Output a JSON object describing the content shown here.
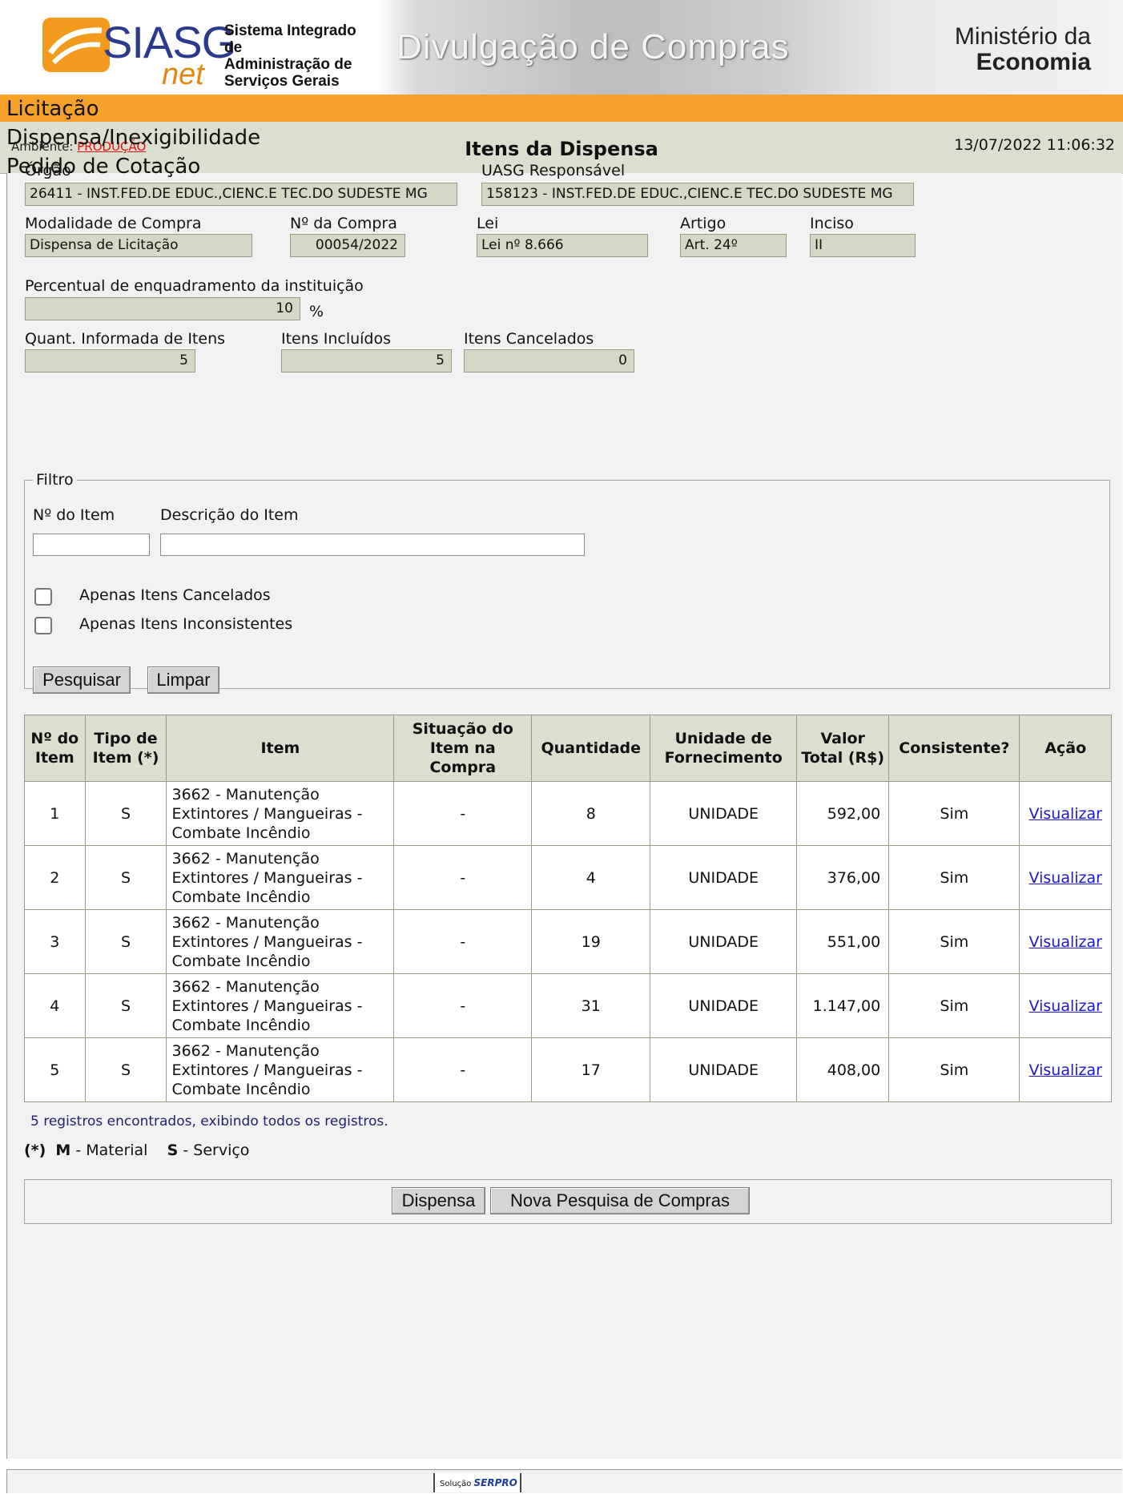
{
  "header": {
    "logo_siasg": "SIASG",
    "logo_net": "net",
    "system_name": "Sistema Integrado de\nAdministração de\nServiços Gerais",
    "site_title": "Divulgação de Compras",
    "ministry_line1": "Ministério da",
    "ministry_line2": "Economia"
  },
  "menu": {
    "items": [
      "Licitação",
      "Dispensa/Inexigibilidade",
      "Pedido de Cotação"
    ]
  },
  "title_bar": {
    "ambiente_label": "Ambiente:",
    "ambiente_value": "PRODUÇÃO",
    "title": "Itens da Dispensa",
    "datetime": "13/07/2022 11:06:32"
  },
  "form": {
    "orgao_label": "Órgão",
    "orgao_value": "26411 - INST.FED.DE EDUC.,CIENC.E TEC.DO SUDESTE MG",
    "uasg_label": "UASG Responsável",
    "uasg_value": "158123 - INST.FED.DE EDUC.,CIENC.E TEC.DO SUDESTE MG",
    "modalidade_label": "Modalidade de Compra",
    "modalidade_value": "Dispensa de Licitação",
    "numero_label": "Nº da Compra",
    "numero_value": "00054/2022",
    "lei_label": "Lei",
    "lei_value": "Lei nº 8.666",
    "artigo_label": "Artigo",
    "artigo_value": "Art. 24º",
    "inciso_label": "Inciso",
    "inciso_value": "II",
    "percentual_label": "Percentual de enquadramento da instituição",
    "percentual_value": "10",
    "percentual_unit": "%",
    "quant_label": "Quant. Informada de Itens",
    "quant_value": "5",
    "incluidos_label": "Itens Incluídos",
    "incluidos_value": "5",
    "cancelados_label": "Itens Cancelados",
    "cancelados_value": "0"
  },
  "filter": {
    "legend": "Filtro",
    "item_no_label": "Nº do Item",
    "item_no_value": "",
    "descricao_label": "Descrição do Item",
    "descricao_value": "",
    "chk_cancelados": "Apenas Itens Cancelados",
    "chk_inconsistentes": "Apenas Itens Inconsistentes",
    "btn_pesquisar": "Pesquisar",
    "btn_limpar": "Limpar"
  },
  "table": {
    "headers": [
      "Nº do Item",
      "Tipo de Item (*)",
      "Item",
      "Situação do Item na Compra",
      "Quantidade",
      "Unidade de Fornecimento",
      "Valor Total (R$)",
      "Consistente?",
      "Ação"
    ],
    "rows": [
      {
        "n": "1",
        "tipo": "S",
        "item": "3662 - Manutenção Extintores / Mangueiras - Combate Incêndio",
        "situacao": "-",
        "quantidade": "8",
        "unidade": "UNIDADE",
        "valor": "592,00",
        "consistente": "Sim",
        "acao": "Visualizar"
      },
      {
        "n": "2",
        "tipo": "S",
        "item": "3662 - Manutenção Extintores / Mangueiras - Combate Incêndio",
        "situacao": "-",
        "quantidade": "4",
        "unidade": "UNIDADE",
        "valor": "376,00",
        "consistente": "Sim",
        "acao": "Visualizar"
      },
      {
        "n": "3",
        "tipo": "S",
        "item": "3662 - Manutenção Extintores / Mangueiras - Combate Incêndio",
        "situacao": "-",
        "quantidade": "19",
        "unidade": "UNIDADE",
        "valor": "551,00",
        "consistente": "Sim",
        "acao": "Visualizar"
      },
      {
        "n": "4",
        "tipo": "S",
        "item": "3662 - Manutenção Extintores / Mangueiras - Combate Incêndio",
        "situacao": "-",
        "quantidade": "31",
        "unidade": "UNIDADE",
        "valor": "1.147,00",
        "consistente": "Sim",
        "acao": "Visualizar"
      },
      {
        "n": "5",
        "tipo": "S",
        "item": "3662 - Manutenção Extintores / Mangueiras - Combate Incêndio",
        "situacao": "-",
        "quantidade": "17",
        "unidade": "UNIDADE",
        "valor": "408,00",
        "consistente": "Sim",
        "acao": "Visualizar"
      }
    ]
  },
  "records_text": "5 registros encontrados, exibindo todos os registros.",
  "legend": {
    "marker": "(*)",
    "m_code": "M",
    "m_text": "- Material",
    "s_code": "S",
    "s_text": "- Serviço"
  },
  "actions": {
    "btn_dispensa": "Dispensa",
    "btn_nova_pesquisa": "Nova Pesquisa de Compras"
  },
  "footer": {
    "solucao": "Solução",
    "serpro": "SERPRO"
  },
  "colors": {
    "menu_bar": "#f6a12a",
    "title_bar": "#deded0",
    "readonly_field": "#d7d7c5",
    "link": "#1a1ad0",
    "ambiente_value": "#e01010"
  }
}
